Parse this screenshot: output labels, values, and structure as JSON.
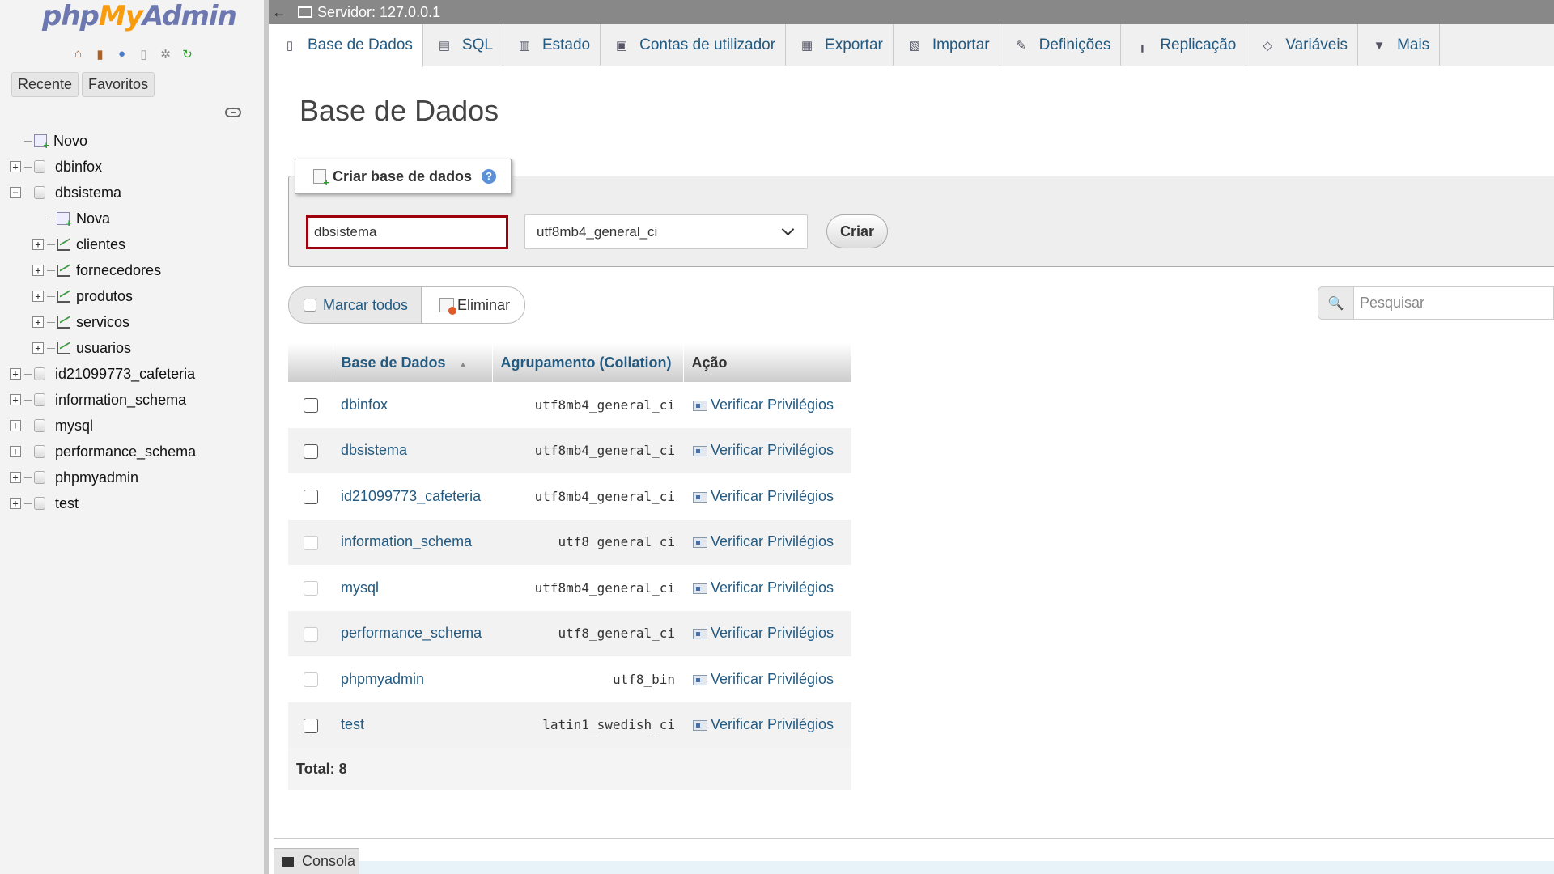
{
  "nav": {
    "logo": {
      "php": "php",
      "my": "My",
      "admin": "Admin"
    },
    "icons": [
      "home-icon",
      "exit-icon",
      "help-icon",
      "docs-icon",
      "settings-icon",
      "reload-icon"
    ],
    "tabs": {
      "recent": "Recente",
      "favorites": "Favoritos"
    },
    "tree": [
      {
        "label": "Novo",
        "kind": "new"
      },
      {
        "label": "dbinfox",
        "kind": "db",
        "expander": "+"
      },
      {
        "label": "dbsistema",
        "kind": "db",
        "expander": "−"
      },
      {
        "label": "Nova",
        "kind": "new-child"
      },
      {
        "label": "clientes",
        "kind": "table",
        "expander": "+"
      },
      {
        "label": "fornecedores",
        "kind": "table",
        "expander": "+"
      },
      {
        "label": "produtos",
        "kind": "table",
        "expander": "+"
      },
      {
        "label": "servicos",
        "kind": "table",
        "expander": "+"
      },
      {
        "label": "usuarios",
        "kind": "table",
        "expander": "+"
      },
      {
        "label": "id21099773_cafeteria",
        "kind": "db",
        "expander": "+"
      },
      {
        "label": "information_schema",
        "kind": "db",
        "expander": "+"
      },
      {
        "label": "mysql",
        "kind": "db",
        "expander": "+"
      },
      {
        "label": "performance_schema",
        "kind": "db",
        "expander": "+"
      },
      {
        "label": "phpmyadmin",
        "kind": "db",
        "expander": "+"
      },
      {
        "label": "test",
        "kind": "db",
        "expander": "+"
      }
    ]
  },
  "serverbar": {
    "back": "←",
    "title": "Servidor: 127.0.0.1"
  },
  "menu": [
    {
      "label": "Base de Dados",
      "icon": "database-icon",
      "glyph": "▯",
      "active": true
    },
    {
      "label": "SQL",
      "icon": "sql-icon",
      "glyph": "▤"
    },
    {
      "label": "Estado",
      "icon": "status-icon",
      "glyph": "▥"
    },
    {
      "label": "Contas de utilizador",
      "icon": "users-icon",
      "glyph": "▣"
    },
    {
      "label": "Exportar",
      "icon": "export-icon",
      "glyph": "▦"
    },
    {
      "label": "Importar",
      "icon": "import-icon",
      "glyph": "▧"
    },
    {
      "label": "Definições",
      "icon": "settings-icon",
      "glyph": "✎"
    },
    {
      "label": "Replicação",
      "icon": "replication-icon",
      "glyph": "╻"
    },
    {
      "label": "Variáveis",
      "icon": "variables-icon",
      "glyph": "◇"
    },
    {
      "label": "Mais",
      "icon": "more-icon",
      "glyph": "▼"
    }
  ],
  "main": {
    "title": "Base de Dados",
    "create": {
      "legend": "Criar base de dados",
      "help": "?",
      "name_value": "dbsistema",
      "collation_value": "utf8mb4_general_ci",
      "button": "Criar"
    },
    "toolbar": {
      "mark_all": "Marcar todos",
      "delete": "Eliminar"
    },
    "search": {
      "placeholder": "Pesquisar"
    },
    "table": {
      "headers": {
        "name": "Base de Dados",
        "sort": "▲",
        "collation": "Agrupamento (Collation)",
        "action": "Ação"
      },
      "rows": [
        {
          "name": "dbinfox",
          "collation": "utf8mb4_general_ci",
          "action": "Verificar Privilégios",
          "enabled": true
        },
        {
          "name": "dbsistema",
          "collation": "utf8mb4_general_ci",
          "action": "Verificar Privilégios",
          "enabled": true
        },
        {
          "name": "id21099773_cafeteria",
          "collation": "utf8mb4_general_ci",
          "action": "Verificar Privilégios",
          "enabled": true
        },
        {
          "name": "information_schema",
          "collation": "utf8_general_ci",
          "action": "Verificar Privilégios",
          "enabled": false
        },
        {
          "name": "mysql",
          "collation": "utf8mb4_general_ci",
          "action": "Verificar Privilégios",
          "enabled": false
        },
        {
          "name": "performance_schema",
          "collation": "utf8_general_ci",
          "action": "Verificar Privilégios",
          "enabled": false
        },
        {
          "name": "phpmyadmin",
          "collation": "utf8_bin",
          "action": "Verificar Privilégios",
          "enabled": false
        },
        {
          "name": "test",
          "collation": "latin1_swedish_ci",
          "action": "Verificar Privilégios",
          "enabled": true
        }
      ],
      "total": "Total: 8"
    }
  },
  "console": {
    "label": "Consola"
  },
  "colors": {
    "link": "#235a81",
    "highlight_border": "#a0000e",
    "server_bar": "#888888"
  }
}
